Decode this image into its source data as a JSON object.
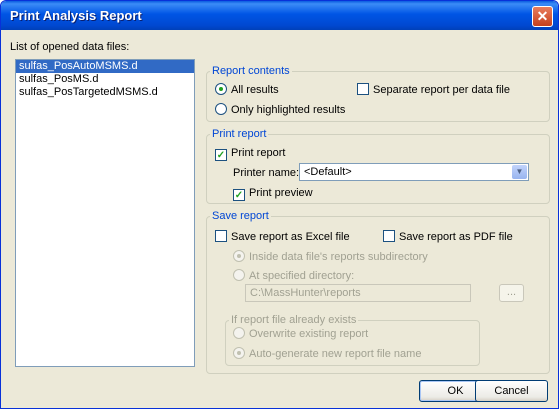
{
  "window": {
    "title": "Print Analysis Report",
    "close_glyph": "✕"
  },
  "files": {
    "label": "List of opened data files:",
    "items": [
      "sulfas_PosAutoMSMS.d",
      "sulfas_PosMS.d",
      "sulfas_PosTargetedMSMS.d"
    ],
    "selected_index": 0
  },
  "report_contents": {
    "legend": "Report contents",
    "all_results": "All results",
    "only_highlighted": "Only highlighted results",
    "separate_report": "Separate report per data file",
    "selected": "all_results",
    "separate_checked": false
  },
  "print_report": {
    "legend": "Print report",
    "print_label": "Print report",
    "print_checked": true,
    "printer_name_label": "Printer name:",
    "printer_value": "<Default>",
    "preview_label": "Print preview",
    "preview_checked": true
  },
  "save_report": {
    "legend": "Save report",
    "excel_label": "Save report as Excel file",
    "excel_checked": false,
    "pdf_label": "Save report as PDF file",
    "pdf_checked": false,
    "inside_label": "Inside data file's reports subdirectory",
    "specified_label": "At specified directory:",
    "directory_value": "C:\\MassHunter\\reports",
    "browse_label": "...",
    "exists_legend": "If report file already exists",
    "overwrite_label": "Overwrite existing report",
    "autogen_label": "Auto-generate new report file name"
  },
  "buttons": {
    "ok": "OK",
    "cancel": "Cancel"
  },
  "colors": {
    "title_bar": "#0055e5",
    "group_label": "#0046d5",
    "selection": "#316ac5"
  }
}
